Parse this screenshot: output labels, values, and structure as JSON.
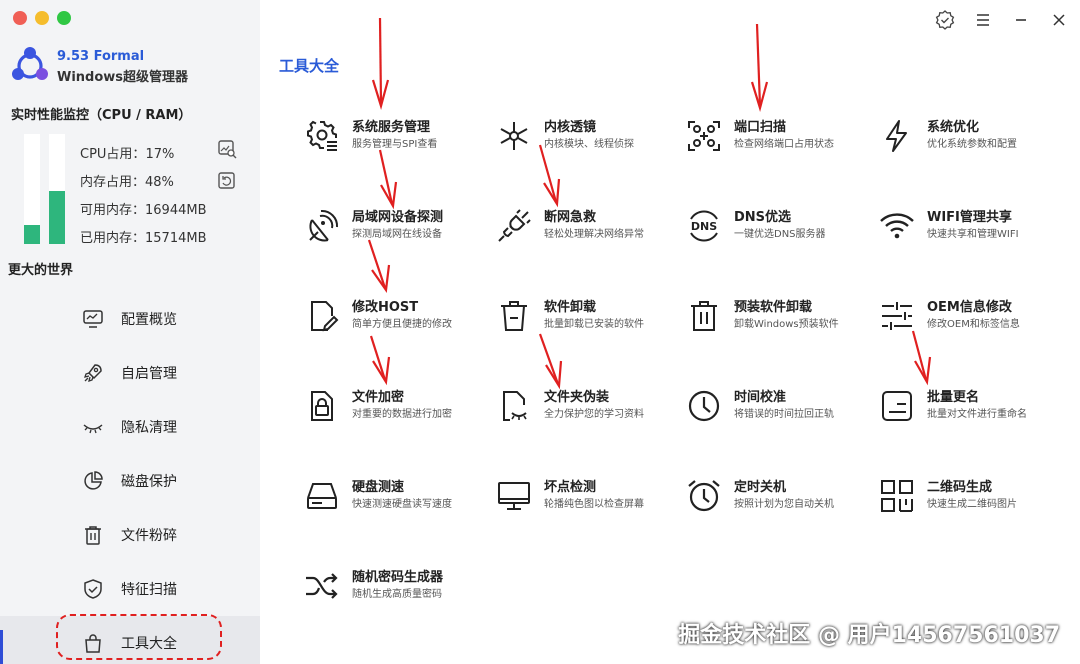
{
  "window": {
    "traffic_colors": [
      "#f05f56",
      "#f5bd2d",
      "#30c744"
    ],
    "buttons": [
      "verify-icon",
      "menu-icon",
      "minimize-icon",
      "close-icon"
    ]
  },
  "brand": {
    "version": "9.53 Formal",
    "name": "Windows超级管理器",
    "accent": "#2a5bd7"
  },
  "monitor": {
    "title": "实时性能监控（CPU / RAM）",
    "cpu_percent": 17,
    "ram_percent": 48,
    "cpu_label": "CPU占用：",
    "cpu_value": "17%",
    "ram_label": "内存占用：",
    "ram_value": "48%",
    "free_label": "可用内存：",
    "free_value": "16944MB",
    "used_label": "已用内存：",
    "used_value": "15714MB",
    "bar_color": "#2eb67d"
  },
  "sidebar": {
    "world_title": "更大的世界",
    "items": [
      {
        "label": "配置概览",
        "icon": "monitor-icon"
      },
      {
        "label": "自启管理",
        "icon": "rocket-icon"
      },
      {
        "label": "隐私清理",
        "icon": "closed-eye-icon"
      },
      {
        "label": "磁盘保护",
        "icon": "pie-chart-icon"
      },
      {
        "label": "文件粉碎",
        "icon": "trash-icon"
      },
      {
        "label": "特征扫描",
        "icon": "shield-check-icon"
      },
      {
        "label": "工具大全",
        "icon": "bag-icon",
        "active": true
      }
    ]
  },
  "main": {
    "title": "工具大全",
    "tools": [
      {
        "name": "系统服务管理",
        "desc": "服务管理与SPI查看",
        "icon": "gear-list-icon"
      },
      {
        "name": "内核透镜",
        "desc": "内核模块、线程侦探",
        "icon": "kernel-icon"
      },
      {
        "name": "端口扫描",
        "desc": "检查网络端口占用状态",
        "icon": "port-scan-icon"
      },
      {
        "name": "系统优化",
        "desc": "优化系统参数和配置",
        "icon": "lightning-icon"
      },
      {
        "name": "局域网设备探测",
        "desc": "探测局域网在线设备",
        "icon": "radar-icon"
      },
      {
        "name": "断网急救",
        "desc": "轻松处理解决网络异常",
        "icon": "plug-icon"
      },
      {
        "name": "DNS优选",
        "desc": "一键优选DNS服务器",
        "icon": "dns-icon"
      },
      {
        "name": "WIFI管理共享",
        "desc": "快速共享和管理WIFI",
        "icon": "wifi-icon"
      },
      {
        "name": "修改HOST",
        "desc": "简单方便且便捷的修改",
        "icon": "file-edit-icon"
      },
      {
        "name": "软件卸载",
        "desc": "批量卸载已安装的软件",
        "icon": "uninstall-icon"
      },
      {
        "name": "预装软件卸载",
        "desc": "卸载Windows预装软件",
        "icon": "preinstall-uninstall-icon"
      },
      {
        "name": "OEM信息修改",
        "desc": "修改OEM和标签信息",
        "icon": "sliders-icon"
      },
      {
        "name": "文件加密",
        "desc": "对重要的数据进行加密",
        "icon": "file-lock-icon"
      },
      {
        "name": "文件夹伪装",
        "desc": "全力保护您的学习资料",
        "icon": "file-disguise-icon"
      },
      {
        "name": "时间校准",
        "desc": "将错误的时间拉回正轨",
        "icon": "clock-icon"
      },
      {
        "name": "批量更名",
        "desc": "批量对文件进行重命名",
        "icon": "rename-icon"
      },
      {
        "name": "硬盘测速",
        "desc": "快速测速硬盘读写速度",
        "icon": "disk-icon"
      },
      {
        "name": "坏点检测",
        "desc": "轮播纯色图以检查屏幕",
        "icon": "screen-icon"
      },
      {
        "name": "定时关机",
        "desc": "按照计划为您自动关机",
        "icon": "alarm-icon"
      },
      {
        "name": "二维码生成",
        "desc": "快速生成二维码图片",
        "icon": "qrcode-icon"
      },
      {
        "name": "随机密码生成器",
        "desc": "随机生成高质量密码",
        "icon": "shuffle-icon"
      }
    ]
  },
  "annotation_color": "#e02020",
  "watermark": "掘金技术社区 @ 用户14567561037"
}
